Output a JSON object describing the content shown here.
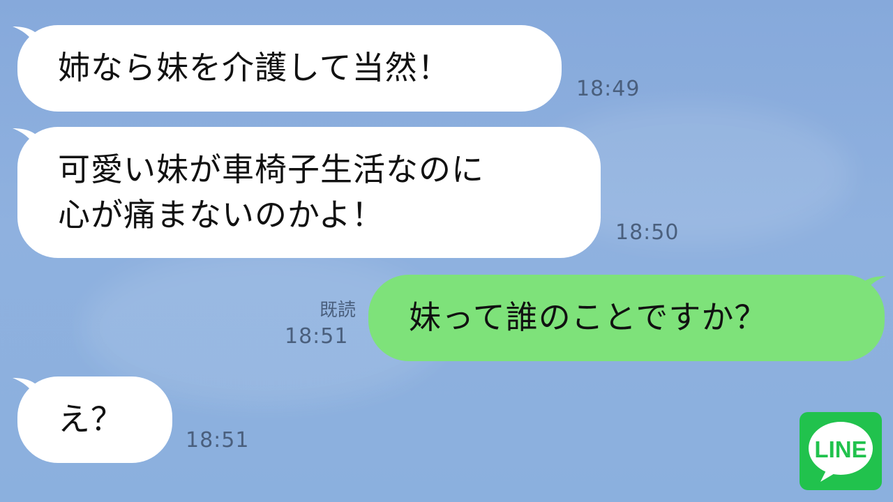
{
  "messages": [
    {
      "side": "incoming",
      "lines": [
        "姉なら妹を介護して当然！"
      ],
      "time": "18:49"
    },
    {
      "side": "incoming",
      "lines": [
        "可愛い妹が車椅子生活なのに",
        "心が痛まないのかよ！"
      ],
      "time": "18:50"
    },
    {
      "side": "outgoing",
      "lines": [
        "妹って誰のことですか？"
      ],
      "read_label": "既読",
      "time": "18:51"
    },
    {
      "side": "incoming",
      "lines": [
        "え？"
      ],
      "time": "18:51"
    }
  ],
  "logo": {
    "text": "LINE",
    "color": "#21c24d"
  },
  "colors": {
    "background": "#88abdc",
    "incoming_bubble": "#ffffff",
    "outgoing_bubble": "#7ee27a",
    "timestamp": "#4a5f7d"
  }
}
